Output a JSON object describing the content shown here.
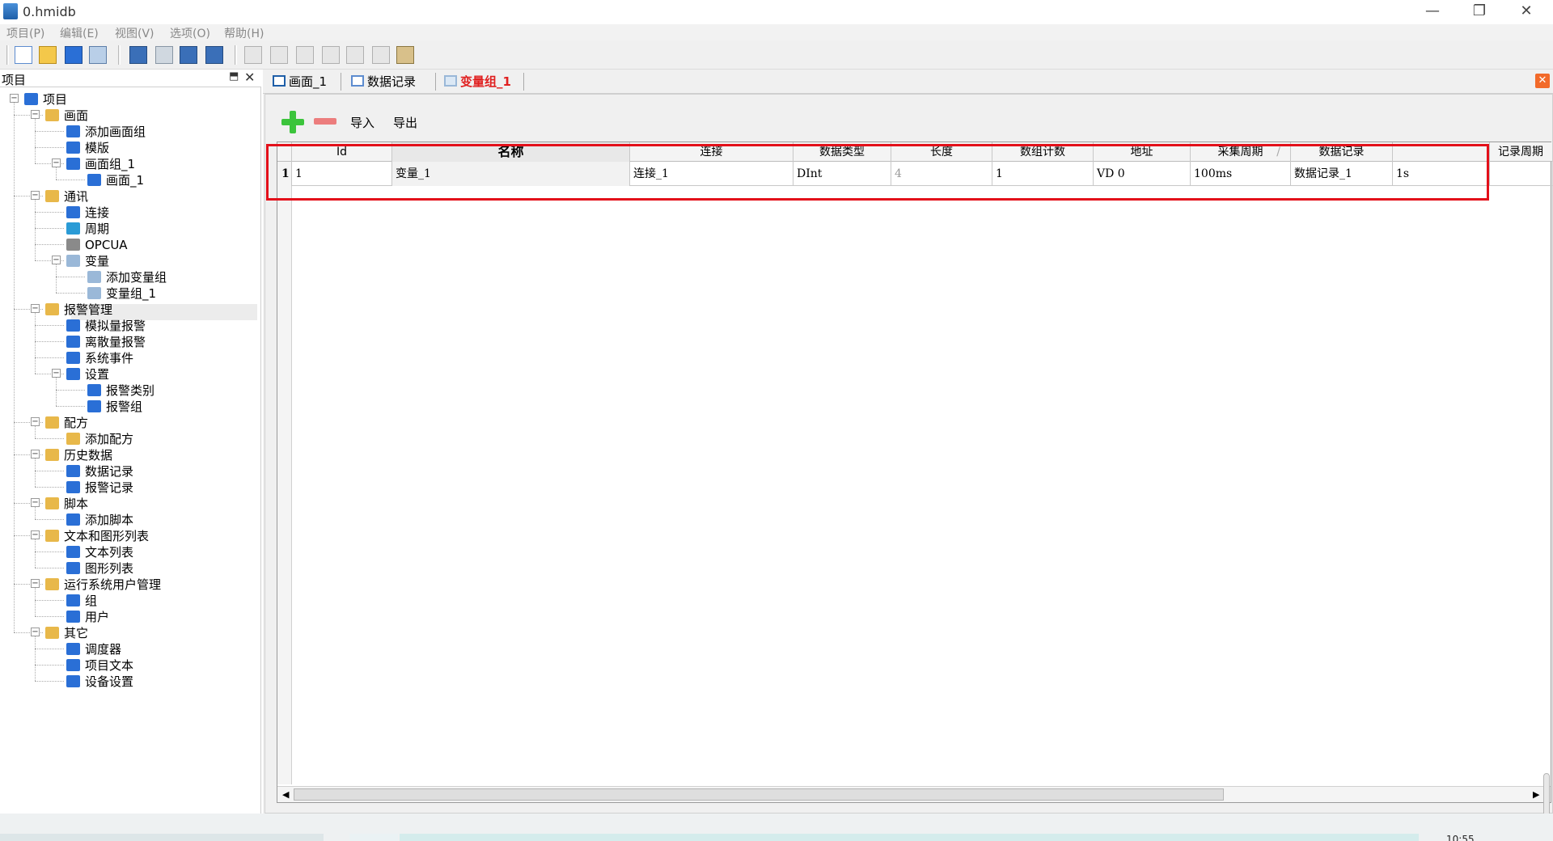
{
  "window": {
    "title": "0.hmidb",
    "minimize_glyph": "—",
    "restore_glyph": "❐",
    "close_glyph": "✕"
  },
  "menu": [
    "项目(P)",
    "编辑(E)",
    "视图(V)",
    "选项(O)",
    "帮助(H)"
  ],
  "toolbar": {
    "icons": [
      "new-file-icon",
      "open-folder-icon",
      "save-icon",
      "print-icon",
      "screen-settings-icon",
      "download-icon",
      "upload-icon",
      "transfer-icon",
      "undo-icon",
      "redo-icon",
      "cut-icon",
      "copy-icon",
      "paste-icon",
      "delete-icon",
      "find-icon"
    ]
  },
  "project_panel": {
    "title": "项目",
    "pin_glyph": "⬒",
    "close_glyph": "✕",
    "tree": [
      {
        "label": "项目",
        "level": 0,
        "icon": "project-icon",
        "color": "#2a6fd6",
        "expander": "⊟"
      },
      {
        "label": "画面",
        "level": 1,
        "icon": "screen-folder-icon",
        "color": "#e8b84a",
        "expander": "⊟"
      },
      {
        "label": "添加画面组",
        "level": 2,
        "icon": "add-screen-group-icon",
        "color": "#2a6fd6"
      },
      {
        "label": "模版",
        "level": 2,
        "icon": "template-icon",
        "color": "#2a6fd6"
      },
      {
        "label": "画面组_1",
        "level": 2,
        "icon": "screen-group-icon",
        "color": "#2a6fd6",
        "expander": "⊟"
      },
      {
        "label": "画面_1",
        "level": 3,
        "icon": "screen-icon",
        "color": "#2a6fd6"
      },
      {
        "label": "通讯",
        "level": 1,
        "icon": "communication-folder-icon",
        "color": "#e8b84a",
        "expander": "⊟"
      },
      {
        "label": "连接",
        "level": 2,
        "icon": "connection-icon",
        "color": "#2a6fd6"
      },
      {
        "label": "周期",
        "level": 2,
        "icon": "cycle-icon",
        "color": "#2a9bd6"
      },
      {
        "label": "OPCUA",
        "level": 2,
        "icon": "opcua-icon",
        "color": "#8a8a8a"
      },
      {
        "label": "变量",
        "level": 2,
        "icon": "variable-icon",
        "color": "#9ab8d8",
        "expander": "⊟"
      },
      {
        "label": "添加变量组",
        "level": 3,
        "icon": "add-variable-group-icon",
        "color": "#9ab8d8"
      },
      {
        "label": "变量组_1",
        "level": 3,
        "icon": "variable-group-icon",
        "color": "#9ab8d8"
      },
      {
        "label": "报警管理",
        "level": 1,
        "icon": "alarm-folder-icon",
        "color": "#e8b84a",
        "expander": "⊟"
      },
      {
        "label": "模拟量报警",
        "level": 2,
        "icon": "analog-alarm-icon",
        "color": "#2a6fd6"
      },
      {
        "label": "离散量报警",
        "level": 2,
        "icon": "discrete-alarm-icon",
        "color": "#2a6fd6"
      },
      {
        "label": "系统事件",
        "level": 2,
        "icon": "system-event-icon",
        "color": "#2a6fd6"
      },
      {
        "label": "设置",
        "level": 2,
        "icon": "settings-icon",
        "color": "#2a6fd6",
        "expander": "⊟"
      },
      {
        "label": "报警类别",
        "level": 3,
        "icon": "alarm-class-icon",
        "color": "#2a6fd6"
      },
      {
        "label": "报警组",
        "level": 3,
        "icon": "alarm-group-icon",
        "color": "#2a6fd6"
      },
      {
        "label": "配方",
        "level": 1,
        "icon": "recipe-folder-icon",
        "color": "#e8b84a",
        "expander": "⊟"
      },
      {
        "label": "添加配方",
        "level": 2,
        "icon": "add-recipe-icon",
        "color": "#e8b84a"
      },
      {
        "label": "历史数据",
        "level": 1,
        "icon": "history-folder-icon",
        "color": "#e8b84a",
        "expander": "⊟"
      },
      {
        "label": "数据记录",
        "level": 2,
        "icon": "data-log-icon",
        "color": "#2a6fd6"
      },
      {
        "label": "报警记录",
        "level": 2,
        "icon": "alarm-log-icon",
        "color": "#2a6fd6"
      },
      {
        "label": "脚本",
        "level": 1,
        "icon": "script-folder-icon",
        "color": "#e8b84a",
        "expander": "⊟"
      },
      {
        "label": "添加脚本",
        "level": 2,
        "icon": "add-script-icon",
        "color": "#2a6fd6"
      },
      {
        "label": "文本和图形列表",
        "level": 1,
        "icon": "list-folder-icon",
        "color": "#e8b84a",
        "expander": "⊟"
      },
      {
        "label": "文本列表",
        "level": 2,
        "icon": "text-list-icon",
        "color": "#2a6fd6"
      },
      {
        "label": "图形列表",
        "level": 2,
        "icon": "graphic-list-icon",
        "color": "#2a6fd6"
      },
      {
        "label": "运行系统用户管理",
        "level": 1,
        "icon": "user-admin-folder-icon",
        "color": "#e8b84a",
        "expander": "⊟"
      },
      {
        "label": "组",
        "level": 2,
        "icon": "group-icon",
        "color": "#2a6fd6"
      },
      {
        "label": "用户",
        "level": 2,
        "icon": "user-icon",
        "color": "#2a6fd6"
      },
      {
        "label": "其它",
        "level": 1,
        "icon": "other-folder-icon",
        "color": "#e8b84a",
        "expander": "⊟"
      },
      {
        "label": "调度器",
        "level": 2,
        "icon": "scheduler-icon",
        "color": "#2a6fd6"
      },
      {
        "label": "项目文本",
        "level": 2,
        "icon": "project-text-icon",
        "color": "#2a6fd6"
      },
      {
        "label": "设备设置",
        "level": 2,
        "icon": "device-settings-icon",
        "color": "#2a6fd6"
      }
    ]
  },
  "tabs": [
    {
      "label": "画面_1",
      "icon": "screen-tab-icon"
    },
    {
      "label": "数据记录",
      "icon": "data-log-tab-icon"
    },
    {
      "label": "变量组_1",
      "icon": "variable-group-tab-icon"
    }
  ],
  "editor_close_glyph": "✕",
  "actions": {
    "import_label": "导入",
    "export_label": "导出"
  },
  "grid": {
    "columns": [
      "Id",
      "名称",
      "连接",
      "数据类型",
      "长度",
      "数组计数",
      "地址",
      "采集周期",
      "数据记录",
      "",
      "记录周期"
    ],
    "row_number": "1",
    "row": [
      "1",
      "变量_1",
      "连接_1",
      "DInt",
      "4",
      "1",
      "VD 0",
      "100ms",
      "数据记录_1",
      "1s",
      ""
    ],
    "sort_indicator": "/",
    "scroll_left_glyph": "◀",
    "scroll_right_glyph": "▶"
  },
  "taskbar": {
    "time": "10:55"
  },
  "colors": {
    "highlight": "#e3101a",
    "active_tab": "#e02020",
    "add": "#3cc43c",
    "remove": "#ec7d7d"
  }
}
